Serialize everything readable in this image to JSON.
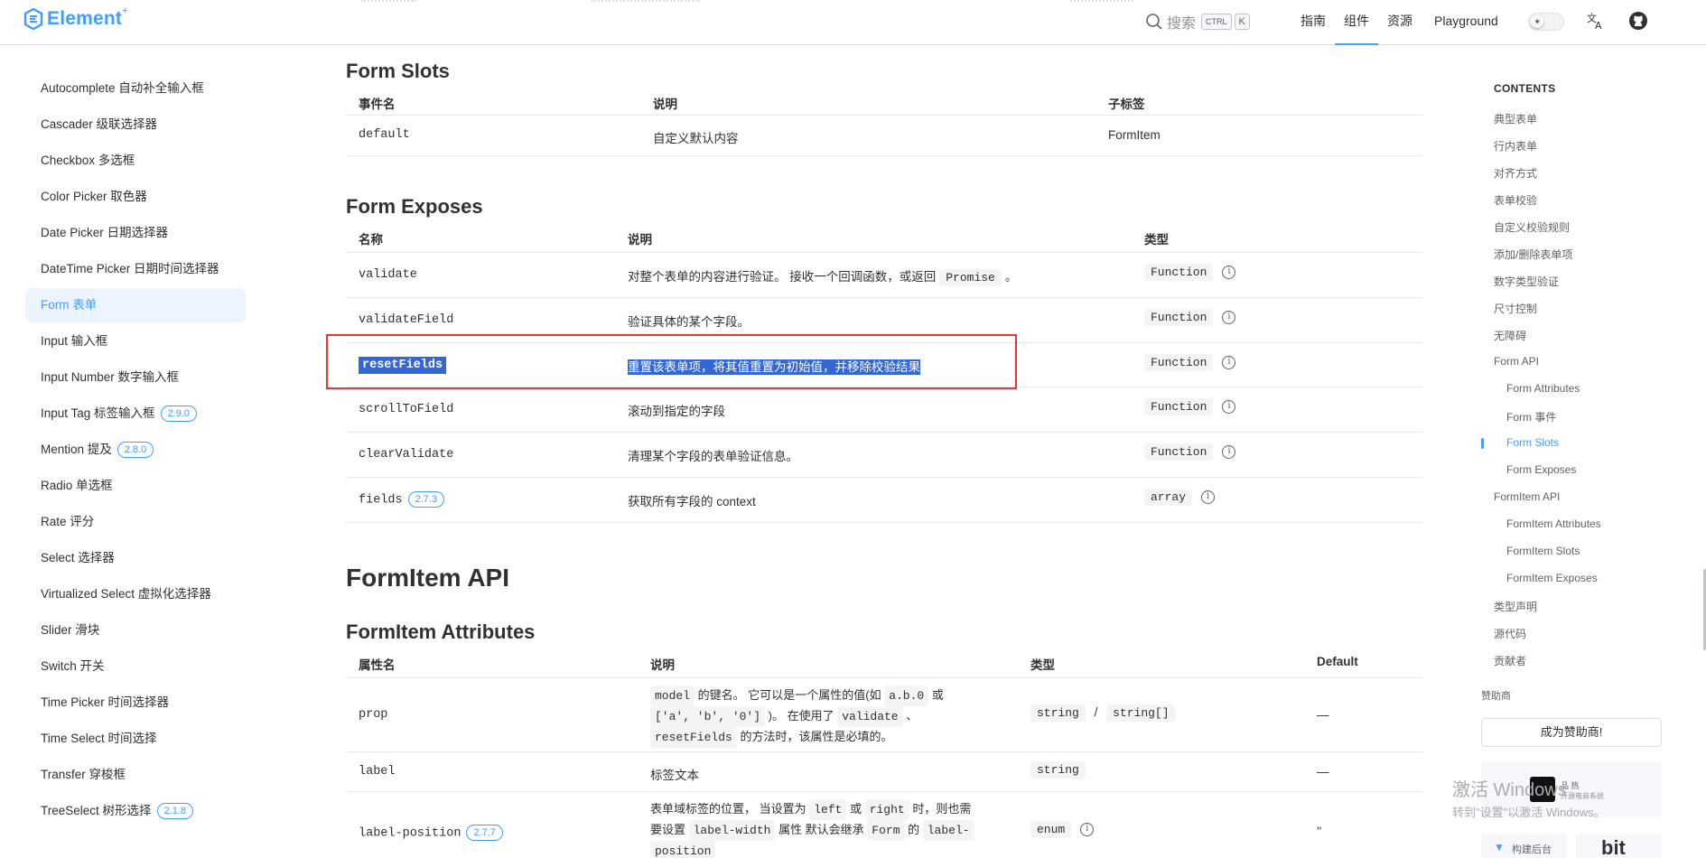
{
  "header": {
    "logo_text": "Element",
    "logo_sup": "+",
    "search_label": "搜索",
    "kbd_ctrl": "CTRL",
    "kbd_k": "K",
    "nav": [
      "指南",
      "组件",
      "资源",
      "Playground"
    ],
    "active_nav": "组件",
    "toggle_icon": "sun-icon",
    "translate_icon": "translate-icon",
    "github_icon": "github-icon"
  },
  "sidebar": {
    "items": [
      {
        "label": "Autocomplete 自动补全输入框",
        "badge": ""
      },
      {
        "label": "Cascader 级联选择器",
        "badge": ""
      },
      {
        "label": "Checkbox 多选框",
        "badge": ""
      },
      {
        "label": "Color Picker 取色器",
        "badge": ""
      },
      {
        "label": "Date Picker 日期选择器",
        "badge": ""
      },
      {
        "label": "DateTime Picker 日期时间选择器",
        "badge": ""
      },
      {
        "label": "Form 表单",
        "badge": "",
        "active": true
      },
      {
        "label": "Input 输入框",
        "badge": ""
      },
      {
        "label": "Input Number 数字输入框",
        "badge": ""
      },
      {
        "label": "Input Tag 标签输入框",
        "badge": "2.9.0"
      },
      {
        "label": "Mention 提及",
        "badge": "2.8.0"
      },
      {
        "label": "Radio 单选框",
        "badge": ""
      },
      {
        "label": "Rate 评分",
        "badge": ""
      },
      {
        "label": "Select 选择器",
        "badge": ""
      },
      {
        "label": "Virtualized Select 虚拟化选择器",
        "badge": ""
      },
      {
        "label": "Slider 滑块",
        "badge": ""
      },
      {
        "label": "Switch 开关",
        "badge": ""
      },
      {
        "label": "Time Picker 时间选择器",
        "badge": ""
      },
      {
        "label": "Time Select 时间选择",
        "badge": ""
      },
      {
        "label": "Transfer 穿梭框",
        "badge": ""
      },
      {
        "label": "TreeSelect 树形选择",
        "badge": "2.1.8"
      }
    ]
  },
  "main": {
    "slots": {
      "title": "Form Slots",
      "headers": [
        "事件名",
        "说明",
        "子标签"
      ],
      "rows": [
        [
          "default",
          "自定义默认内容",
          "FormItem"
        ]
      ]
    },
    "exposes": {
      "title": "Form Exposes",
      "headers": [
        "名称",
        "说明",
        "类型"
      ],
      "rows": [
        {
          "name": "validate",
          "badge": "",
          "desc": "对整个表单的内容进行验证。 接收一个回调函数，或返回",
          "desc_code": "Promise",
          "desc_tail": "。",
          "type": "Function"
        },
        {
          "name": "validateField",
          "badge": "",
          "desc": "验证具体的某个字段。",
          "desc_code": "",
          "desc_tail": "",
          "type": "Function"
        },
        {
          "name": "resetFields",
          "badge": "",
          "desc": "重置该表单项，将其值重置为初始值，并移除校验结果",
          "desc_code": "",
          "desc_tail": "",
          "type": "Function",
          "selected": true
        },
        {
          "name": "scrollToField",
          "badge": "",
          "desc": "滚动到指定的字段",
          "desc_code": "",
          "desc_tail": "",
          "type": "Function"
        },
        {
          "name": "clearValidate",
          "badge": "",
          "desc": "清理某个字段的表单验证信息。",
          "desc_code": "",
          "desc_tail": "",
          "type": "Function"
        },
        {
          "name": "fields",
          "badge": "2.7.3",
          "desc": "获取所有字段的 context",
          "desc_code": "",
          "desc_tail": "",
          "type": "array"
        }
      ]
    },
    "formitem_api_title": "FormItem API",
    "formitem_attrs": {
      "title": "FormItem Attributes",
      "headers": [
        "属性名",
        "说明",
        "类型",
        "Default"
      ],
      "prop": {
        "name": "prop",
        "desc_parts": [
          "model",
          " 的键名。 它可以是一个属性的值(如 ",
          "a.b.0",
          " 或",
          "['a', 'b', '0']",
          " )。 在使用了 ",
          "validate",
          " 、",
          "resetFields",
          " 的方法时，该属性是必填的。"
        ],
        "type1": "string",
        "type_sep": "/",
        "type2": "string[]",
        "default": "—"
      },
      "label": {
        "name": "label",
        "desc": "标签文本",
        "type": "string",
        "default": "—"
      },
      "label_position": {
        "name": "label-position",
        "badge": "2.7.7",
        "desc_parts": [
          "表单域标签的位置， 当设置为 ",
          "left",
          " 或 ",
          "right",
          " 时，则也需",
          "要设置 ",
          "label-width",
          " 属性 默认会继承 ",
          "Form",
          " 的 ",
          "label-",
          "position"
        ],
        "type": "enum",
        "default": "''"
      }
    }
  },
  "toc": {
    "head": "CONTENTS",
    "items": [
      {
        "label": "典型表单",
        "level": 1
      },
      {
        "label": "行内表单",
        "level": 1
      },
      {
        "label": "对齐方式",
        "level": 1
      },
      {
        "label": "表单校验",
        "level": 1
      },
      {
        "label": "自定义校验规则",
        "level": 1
      },
      {
        "label": "添加/删除表单项",
        "level": 1
      },
      {
        "label": "数字类型验证",
        "level": 1
      },
      {
        "label": "尺寸控制",
        "level": 1
      },
      {
        "label": "无障碍",
        "level": 1
      },
      {
        "label": "Form API",
        "level": 1
      },
      {
        "label": "Form Attributes",
        "level": 2
      },
      {
        "label": "Form 事件",
        "level": 2
      },
      {
        "label": "Form Slots",
        "level": 2,
        "active": true
      },
      {
        "label": "Form Exposes",
        "level": 2
      },
      {
        "label": "FormItem API",
        "level": 1
      },
      {
        "label": "FormItem Attributes",
        "level": 2
      },
      {
        "label": "FormItem Slots",
        "level": 2
      },
      {
        "label": "FormItem Exposes",
        "level": 2
      },
      {
        "label": "类型声明",
        "level": 1
      },
      {
        "label": "源代码",
        "level": 1
      },
      {
        "label": "贡献者",
        "level": 1
      }
    ],
    "sponsor_label": "赞助商",
    "sponsor_button": "成为赞助商!",
    "sponsor_logo_text1": "品 热",
    "sponsor_logo_text2": "开源电商系统",
    "sponsor2_text": "构建后台",
    "sponsor3_text": "bit"
  },
  "watermark": {
    "line1": "激活 Windows",
    "line2": "转到\"设置\"以激活 Windows。"
  },
  "colors": {
    "accent": "#409eff",
    "selection": "#3367d6",
    "highlight_box": "#e53935"
  }
}
